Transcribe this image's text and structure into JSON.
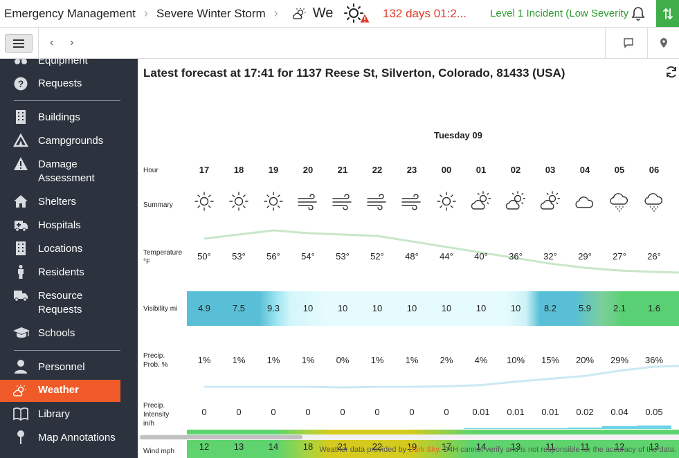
{
  "topbar": {
    "crumbs": [
      "Emergency Management",
      "Severe Winter Storm",
      "We"
    ],
    "timer": "132 days 01:2...",
    "level": "Level 1 Incident (Low Severity"
  },
  "sidebar": {
    "items": [
      {
        "label": "Equipment",
        "icon": "equipment-icon"
      },
      {
        "label": "Requests",
        "icon": "question-icon"
      },
      {
        "label": "Buildings",
        "icon": "building-icon"
      },
      {
        "label": "Campgrounds",
        "icon": "tent-icon"
      },
      {
        "label": "Damage Assessment",
        "line1": "Damage",
        "line2": "Assessment",
        "icon": "warning-icon"
      },
      {
        "label": "Shelters",
        "icon": "home-icon"
      },
      {
        "label": "Hospitals",
        "icon": "ambulance-icon"
      },
      {
        "label": "Locations",
        "icon": "building-icon"
      },
      {
        "label": "Residents",
        "icon": "person-icon"
      },
      {
        "label": "Resource Requests",
        "line1": "Resource",
        "line2": "Requests",
        "icon": "truck-icon"
      },
      {
        "label": "Schools",
        "icon": "graduation-cap-icon"
      },
      {
        "label": "Personnel",
        "icon": "user-icon"
      },
      {
        "label": "Weather",
        "icon": "weather-icon",
        "active": true
      },
      {
        "label": "Library",
        "icon": "book-icon"
      },
      {
        "label": "Map Annotations",
        "icon": "pin-icon"
      }
    ]
  },
  "main": {
    "title": "Latest forecast at 17:41 for 1137 Reese St, Silverton, Colorado, 81433 (USA)",
    "day": "Tuesday 09",
    "row_labels": {
      "hour": "Hour",
      "summary": "Summary",
      "temp_line1": "Temperature",
      "temp_line2": "°F",
      "visibility": "Visibility mi",
      "precip_prob_line1": "Precip.",
      "precip_prob_line2": "Prob. %",
      "precip_int_line1": "Precip.",
      "precip_int_line2": "Intensity",
      "precip_int_line3": "in/h",
      "wind": "Wind mph"
    },
    "hours": [
      "17",
      "18",
      "19",
      "20",
      "21",
      "22",
      "23",
      "00",
      "01",
      "02",
      "03",
      "04",
      "05",
      "06"
    ],
    "summary_icons": [
      "sun-icon",
      "sun-icon",
      "sun-icon",
      "wind-icon",
      "wind-icon",
      "wind-icon",
      "wind-icon",
      "sun-icon",
      "partly-cloudy-icon",
      "partly-cloudy-icon",
      "partly-cloudy-icon",
      "cloud-icon",
      "snow-icon",
      "snow-icon"
    ],
    "temperature": [
      "50°",
      "53°",
      "56°",
      "54°",
      "53°",
      "52°",
      "48°",
      "44°",
      "40°",
      "36°",
      "32°",
      "29°",
      "27°",
      "26°"
    ],
    "visibility": [
      "4.9",
      "7.5",
      "9.3",
      "10",
      "10",
      "10",
      "10",
      "10",
      "10",
      "10",
      "8.2",
      "5.9",
      "2.1",
      "1.6"
    ],
    "precip_prob": [
      "1%",
      "1%",
      "1%",
      "1%",
      "0%",
      "1%",
      "1%",
      "2%",
      "4%",
      "10%",
      "15%",
      "20%",
      "29%",
      "36%"
    ],
    "precip_intensity": [
      "0",
      "0",
      "0",
      "0",
      "0",
      "0",
      "0",
      "0",
      "0.01",
      "0.01",
      "0.01",
      "0.02",
      "0.04",
      "0.05"
    ],
    "wind": [
      "12",
      "13",
      "14",
      "18",
      "21",
      "22",
      "19",
      "17",
      "14",
      "13",
      "11",
      "11",
      "12",
      "13"
    ],
    "credit_prefix": "Weather data provided by ",
    "credit_link": "Dark Sky",
    "credit_suffix": ". D4H cannot verify and is not responsible for the accuracy of the data."
  },
  "colors": {
    "accent": "#f05a28",
    "sidebar_bg": "#2c333e",
    "timer": "#e03a2b",
    "level": "#2e9a2e",
    "action_green": "#3fae49"
  }
}
